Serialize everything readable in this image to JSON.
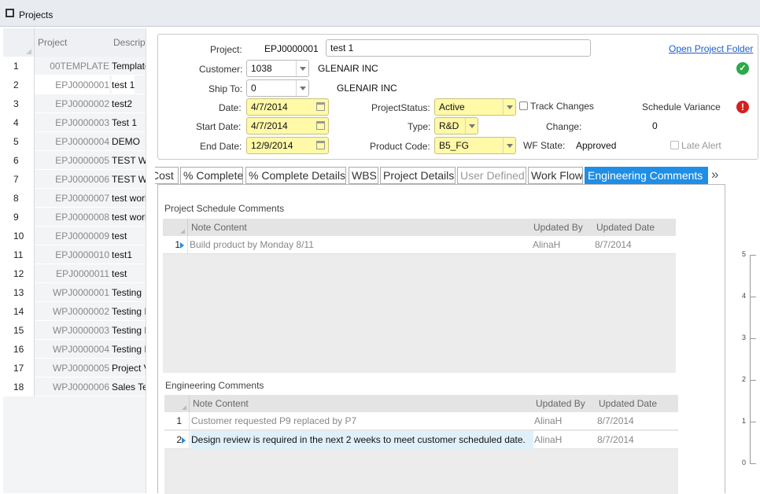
{
  "window": {
    "title": "Projects"
  },
  "grid": {
    "headers": {
      "project": "Project",
      "description": "Descript"
    },
    "rows": [
      {
        "num": "1",
        "code": "00TEMPLATE",
        "desc": "Template"
      },
      {
        "num": "2",
        "code": "EPJ0000001",
        "desc": "test 1"
      },
      {
        "num": "3",
        "code": "EPJ0000002",
        "desc": "test2"
      },
      {
        "num": "4",
        "code": "EPJ0000003",
        "desc": "Test 1"
      },
      {
        "num": "5",
        "code": "EPJ0000004",
        "desc": "DEMO"
      },
      {
        "num": "6",
        "code": "EPJ0000005",
        "desc": "TEST W"
      },
      {
        "num": "7",
        "code": "EPJ0000006",
        "desc": "TEST W"
      },
      {
        "num": "8",
        "code": "EPJ0000007",
        "desc": "test worl"
      },
      {
        "num": "9",
        "code": "EPJ0000008",
        "desc": "test worl"
      },
      {
        "num": "10",
        "code": "EPJ0000009",
        "desc": "test"
      },
      {
        "num": "11",
        "code": "EPJ0000010",
        "desc": "test1"
      },
      {
        "num": "12",
        "code": "EPJ0000011",
        "desc": "test"
      },
      {
        "num": "13",
        "code": "WPJ0000001",
        "desc": "Testing"
      },
      {
        "num": "14",
        "code": "WPJ0000002",
        "desc": "Testing I"
      },
      {
        "num": "15",
        "code": "WPJ0000003",
        "desc": "Testing I"
      },
      {
        "num": "16",
        "code": "WPJ0000004",
        "desc": "Testing I"
      },
      {
        "num": "17",
        "code": "WPJ0000005",
        "desc": "Project V"
      },
      {
        "num": "18",
        "code": "WPJ0000006",
        "desc": "Sales Te"
      }
    ],
    "selected_row": "2"
  },
  "form": {
    "project_label": "Project:",
    "project_code": "EPJ0000001",
    "project_name": "test 1",
    "open_folder": "Open Project Folder",
    "customer_label": "Customer:",
    "customer_value": "1038",
    "customer_name": "GLENAIR INC",
    "shipto_label": "Ship To:",
    "shipto_value": "0",
    "shipto_name": "GLENAIR INC",
    "date_label": "Date:",
    "date_value": "4/7/2014",
    "start_label": "Start Date:",
    "start_value": "4/7/2014",
    "end_label": "End Date:",
    "end_value": "12/9/2014",
    "status_label": "ProjectStatus:",
    "status_value": "Active",
    "track_changes": "Track Changes",
    "schedule_variance": "Schedule Variance",
    "type_label": "Type:",
    "type_value": "R&D",
    "change_label": "Change:",
    "change_value": "0",
    "product_label": "Product Code:",
    "product_value": "B5_FG",
    "wf_label": "WF State:",
    "wf_value": "Approved",
    "late_alert": "Late Alert"
  },
  "tabs": [
    "Cost",
    "% Complete",
    "% Complete Details",
    "WBS",
    "Project Details",
    "User Defined",
    "Work Flow",
    "Engineering Comments"
  ],
  "tabs_more": "»",
  "schedule_comments": {
    "title": "Project Schedule Comments",
    "headers": {
      "note": "Note Content",
      "by": "Updated By",
      "date": "Updated Date"
    },
    "rows": [
      {
        "num": "1",
        "note": "Build product by Monday 8/11",
        "by": "AlinaH",
        "date": "8/7/2014"
      }
    ]
  },
  "engineering_comments": {
    "title": "Engineering Comments",
    "headers": {
      "note": "Note Content",
      "by": "Updated By",
      "date": "Updated Date"
    },
    "rows": [
      {
        "num": "1",
        "note": "Customer requested P9 replaced by P7",
        "by": "AlinaH",
        "date": "8/7/2014"
      },
      {
        "num": "2",
        "note": "Design review is required in the next 2 weeks to meet customer scheduled date.",
        "by": "AlinaH",
        "date": "8/7/2014"
      }
    ]
  },
  "chart_axis": [
    "5",
    "4",
    "3",
    "2",
    "1",
    "0"
  ],
  "colors": {
    "accent": "#1e8ee6",
    "required_field": "#fff9a8",
    "ok": "#2da84a",
    "error": "#d42020"
  }
}
